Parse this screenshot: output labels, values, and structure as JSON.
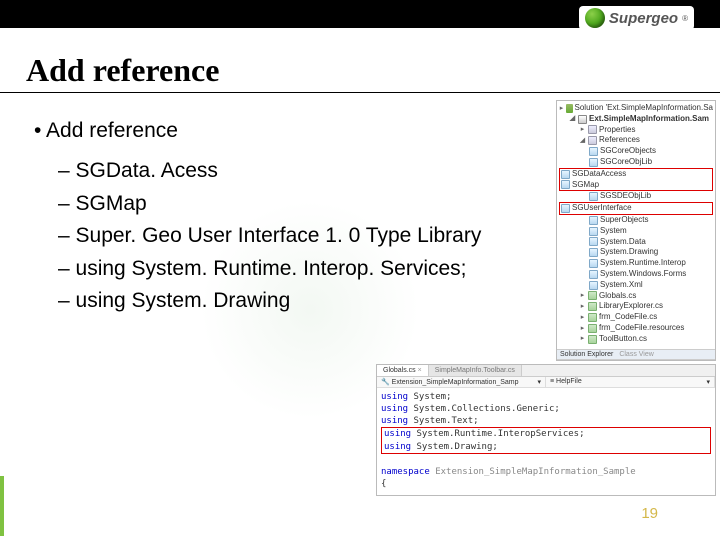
{
  "logo": {
    "brand": "Supergeo",
    "reg": "®"
  },
  "title": "Add reference",
  "bullet": "Add reference",
  "subs": [
    "SGData. Acess",
    "SGMap",
    "Super. Geo User Interface 1. 0 Type Library",
    "using System. Runtime. Interop. Services;",
    "using System. Drawing"
  ],
  "pagenum": "19",
  "sol": {
    "title": "Solution 'Ext.SimpleMapInformation.Sa",
    "proj": "Ext.SimpleMapInformation.Sam",
    "properties": "Properties",
    "references": "References",
    "refs": [
      "SGCoreObjects",
      "SGCoreObjLib",
      "SGDataAccess",
      "SGMap",
      "SGSDEObjLib",
      "SGUserInterface",
      "SuperObjects",
      "System",
      "System.Data",
      "System.Drawing",
      "System.Runtime.Interop",
      "System.Windows.Forms",
      "System.Xml"
    ],
    "cs": [
      "Globals.cs",
      "LibraryExplorer.cs",
      "frm_CodeFile.cs",
      "frm_CodeFile.resources",
      "ToolButton.cs"
    ],
    "classview": "Solution Explorer",
    "props": "Class View"
  },
  "code": {
    "tab1": "Globals.cs",
    "tab2": "SimpleMapInfo.Toolbar.cs",
    "dd1": "Extension_SimpleMapInformation_Samp",
    "dd2": "HelpFile",
    "lines": [
      "using System;",
      "using System.Collections.Generic;",
      "using System.Text;"
    ],
    "red1": "using System.Runtime.InteropServices;",
    "red2": "using System.Drawing;",
    "ns": "namespace Extension_SimpleMapInformation_Sample"
  }
}
